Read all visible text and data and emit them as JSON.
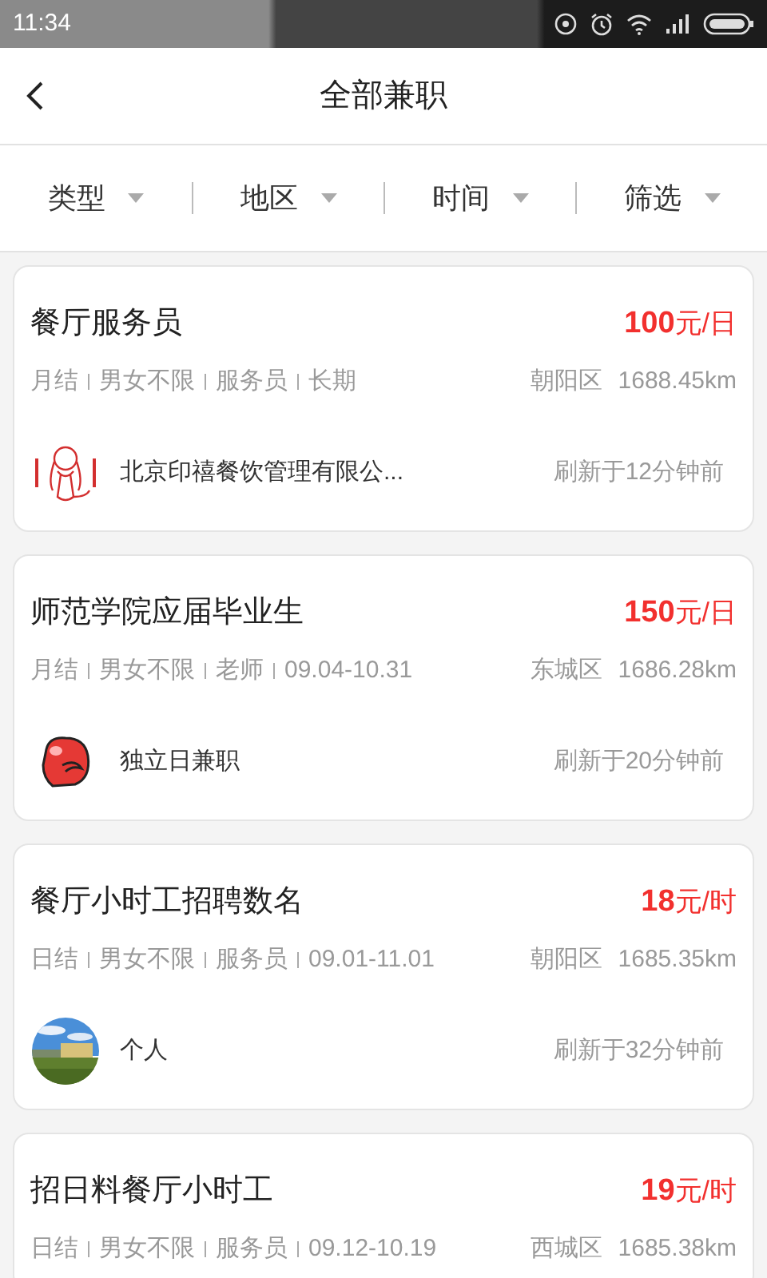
{
  "status_bar": {
    "time": "11:34"
  },
  "header": {
    "title": "全部兼职"
  },
  "filters": [
    {
      "label": "类型"
    },
    {
      "label": "地区"
    },
    {
      "label": "时间"
    },
    {
      "label": "筛选"
    }
  ],
  "jobs": [
    {
      "title": "餐厅服务员",
      "amount": "100",
      "unit": "元/日",
      "tags": [
        "月结",
        "男女不限",
        "服务员",
        "长期"
      ],
      "district": "朝阳区",
      "distance": "1688.45km",
      "avatar": {
        "kind": "sketch"
      },
      "company": "北京印禧餐饮管理有限公...",
      "refreshed": "刷新于12分钟前"
    },
    {
      "title": "师范学院应届毕业生",
      "amount": "150",
      "unit": "元/日",
      "tags": [
        "月结",
        "男女不限",
        "老师",
        "09.04-10.31"
      ],
      "district": "东城区",
      "distance": "1686.28km",
      "avatar": {
        "kind": "glove"
      },
      "company": "独立日兼职",
      "refreshed": "刷新于20分钟前"
    },
    {
      "title": "餐厅小时工招聘数名",
      "amount": "18",
      "unit": "元/时",
      "tags": [
        "日结",
        "男女不限",
        "服务员",
        "09.01-11.01"
      ],
      "district": "朝阳区",
      "distance": "1685.35km",
      "company": "个人",
      "refreshed": "刷新于32分钟前"
    },
    {
      "title": "招日料餐厅小时工",
      "amount": "19",
      "unit": "元/时",
      "tags": [
        "日结",
        "男女不限",
        "服务员",
        "09.12-10.19"
      ],
      "district": "西城区",
      "distance": "1685.38km"
    }
  ]
}
